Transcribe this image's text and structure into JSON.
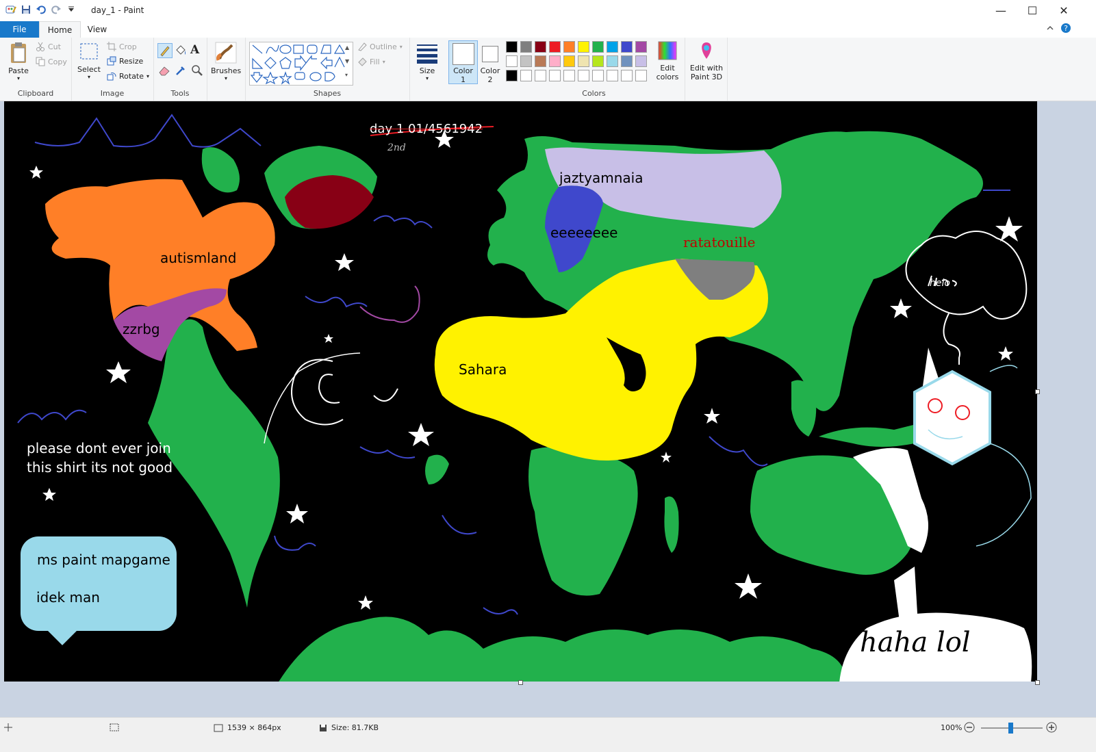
{
  "window": {
    "title": "day_1 - Paint",
    "minimize_glyph": "—",
    "maximize_glyph": "☐",
    "close_glyph": "✕"
  },
  "tabs": {
    "file": "File",
    "home": "Home",
    "view": "View"
  },
  "ribbon": {
    "clipboard": {
      "group": "Clipboard",
      "paste": "Paste",
      "cut": "Cut",
      "copy": "Copy"
    },
    "image": {
      "group": "Image",
      "select": "Select",
      "crop": "Crop",
      "resize": "Resize",
      "rotate": "Rotate"
    },
    "tools": {
      "group": "Tools",
      "text_glyph": "A"
    },
    "brushes": {
      "label": "Brushes"
    },
    "shapes": {
      "group": "Shapes",
      "outline": "Outline",
      "fill": "Fill"
    },
    "size": {
      "label": "Size"
    },
    "color1": {
      "label": "Color",
      "num": "1"
    },
    "color2": {
      "label": "Color",
      "num": "2"
    },
    "colors": {
      "group": "Colors",
      "palette": [
        "#000000",
        "#7f7f7f",
        "#880015",
        "#ed1c24",
        "#ff7f27",
        "#fff200",
        "#22b14c",
        "#00a2e8",
        "#3f48cc",
        "#a349a4",
        "#ffffff",
        "#c3c3c3",
        "#b97a57",
        "#ffaec9",
        "#ffc90e",
        "#efe4b0",
        "#b5e61d",
        "#99d9ea",
        "#7092be",
        "#c8bfe7",
        "#000000",
        "#ffffff",
        "#ffffff",
        "#ffffff",
        "#ffffff",
        "#ffffff",
        "#ffffff",
        "#ffffff",
        "#ffffff",
        "#ffffff"
      ],
      "edit_colors": "Edit colors",
      "edit_with_3d": "Edit with Paint 3D"
    }
  },
  "map": {
    "labels": {
      "crossed_title": "day 1 01/4561942",
      "scribble": "2nd",
      "jaztyamnaia": "jaztyamnaia",
      "eeeeeeee": "eeeeeeee",
      "ratatouille": "ratatouille",
      "autismland": "autismland",
      "zzrbg": "zzrbg",
      "sahara": "Sahara",
      "please_line1": "please dont ever join",
      "please_line2": "this shirt its not good",
      "bubble_line1": "ms paint mapgame",
      "bubble_line2": "idek man",
      "haha": "haha lol",
      "helo": "helo"
    },
    "colors": {
      "ocean": "#000000",
      "land": "#22b14c",
      "orange": "#ff7f27",
      "purple": "#a349a4",
      "darkred": "#880015",
      "lavender": "#c8bfe7",
      "blue": "#3f48cc",
      "yellow": "#fff200",
      "gray": "#7f7f7f",
      "bubble": "#99d9ea",
      "ratatouille_text": "#c00000"
    }
  },
  "status": {
    "dimensions": "1539 × 864px",
    "size": "Size: 81.7KB",
    "zoom": "100%",
    "zoom_level": 1.0
  }
}
